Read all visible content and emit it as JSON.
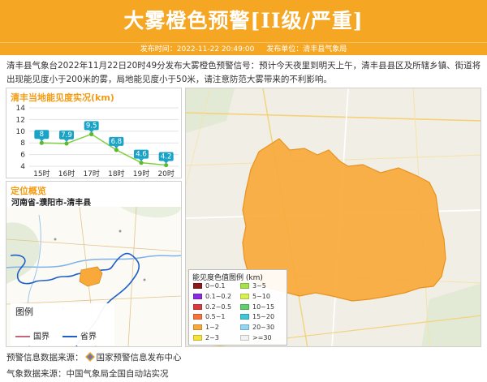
{
  "header": {
    "title": "大雾橙色预警[II级/严重]",
    "publish_time_label": "发布时间：2022-11-22 20:49:00",
    "publisher_label": "发布单位：清丰县气象局"
  },
  "description": "清丰县气象台2022年11月22日20时49分发布大雾橙色预警信号：预计今天夜里到明天上午，清丰县县区及所辖乡镇、街道将出现能见度小于200米的雾，局地能见度小于50米，请注意防范大雾带来的不利影响。",
  "visibility_panel": {
    "title": "清丰当地能见度实况(km)"
  },
  "chart_data": {
    "type": "line",
    "title": "清丰当地能见度实况(km)",
    "categories": [
      "15时",
      "16时",
      "17时",
      "18时",
      "19时",
      "20时"
    ],
    "values": [
      8,
      7.9,
      9.5,
      6.8,
      4.6,
      4.2
    ],
    "value_labels": [
      "8",
      "7.9",
      "9.5",
      "6.8",
      "4.6",
      "4.2"
    ],
    "yticks": [
      "4",
      "6",
      "8",
      "10",
      "12",
      "14"
    ],
    "ylim": [
      4,
      14
    ],
    "grid": true,
    "colors": {
      "line": "#7fcf3f",
      "point": "#5cb82e",
      "label_bg": "#1aa3c6",
      "label_text": "#ffffff"
    }
  },
  "overview": {
    "title": "定位概览",
    "location": "河南省-濮阳市-清丰县",
    "legend_title": "图例",
    "legend_items": [
      {
        "label": "国界",
        "color": "#c8657a"
      },
      {
        "label": "省界",
        "color": "#1f5fc9"
      }
    ]
  },
  "map_legend": {
    "title": "能见度色值图例 (km)",
    "items": [
      {
        "label": "0~0.1",
        "color": "#8b1a1a"
      },
      {
        "label": "3~5",
        "color": "#a6e34a"
      },
      {
        "label": "0.1~0.2",
        "color": "#8a2be2"
      },
      {
        "label": "5~10",
        "color": "#d6f04e"
      },
      {
        "label": "0.2~0.5",
        "color": "#d93b3b"
      },
      {
        "label": "10~15",
        "color": "#5fd16a"
      },
      {
        "label": "0.5~1",
        "color": "#f5733a"
      },
      {
        "label": "15~20",
        "color": "#3fc7d8"
      },
      {
        "label": "1~2",
        "color": "#f8a93a"
      },
      {
        "label": "20~30",
        "color": "#8fd7f2"
      },
      {
        "label": "2~3",
        "color": "#f5e23a"
      },
      {
        "label": ">=30",
        "color": "#f2f2f2"
      }
    ]
  },
  "colors": {
    "header_bg": "#f5a623",
    "warning_area": "#f8a93a",
    "panel_title": "#f39c12"
  },
  "footer": {
    "source1_prefix": "预警信息数据来源：",
    "source1_name": "国家预警信息发布中心",
    "source2_prefix": "气象数据来源：",
    "source2_name": "中国气象局全国自动站实况"
  }
}
